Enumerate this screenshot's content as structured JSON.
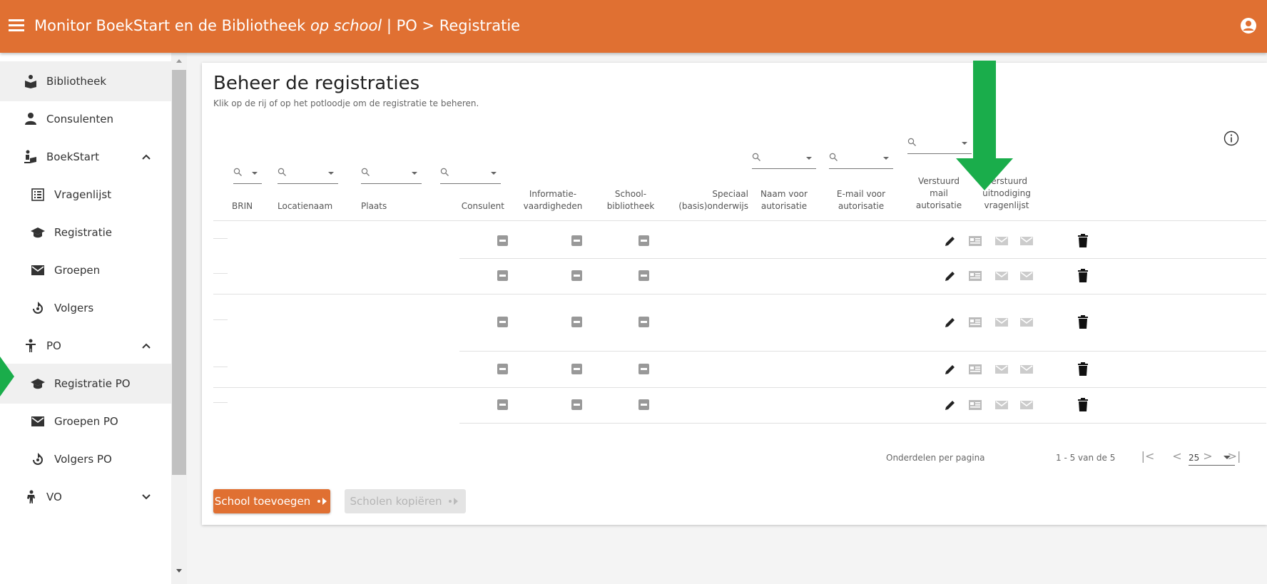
{
  "topbar": {
    "title_prefix": "Monitor BoekStart en de Bibliotheek ",
    "title_italic": "op school",
    "title_suffix": " | PO > Registratie"
  },
  "sidebar": {
    "items": [
      {
        "label": "Bibliotheek",
        "icon": "reading-person-icon"
      },
      {
        "label": "Consulenten",
        "icon": "person-icon"
      },
      {
        "label": "BoekStart",
        "icon": "baby-reading-icon"
      },
      {
        "label": "Vragenlijst",
        "icon": "list-icon"
      },
      {
        "label": "Registratie",
        "icon": "graduation-cap-icon"
      },
      {
        "label": "Groepen",
        "icon": "envelope-icon"
      },
      {
        "label": "Volgers",
        "icon": "follow-icon"
      },
      {
        "label": "PO",
        "icon": "child-icon"
      },
      {
        "label": "Registratie PO",
        "icon": "graduation-cap-icon"
      },
      {
        "label": "Groepen PO",
        "icon": "envelope-icon"
      },
      {
        "label": "Volgers PO",
        "icon": "follow-icon"
      },
      {
        "label": "VO",
        "icon": "teen-icon"
      }
    ]
  },
  "main": {
    "title": "Beheer de registraties",
    "subtitle": "Klik op de rij of op het potloodje om de registratie te beheren.",
    "columns": {
      "brin": "BRIN",
      "locatienaam": "Locatienaam",
      "plaats": "Plaats",
      "consulent": "Consulent",
      "informatie": "Informatie-\nvaardigheden",
      "school": "School-\nbibliotheek",
      "speciaal": "Speciaal\n(basis)onderwijs",
      "naam": "Naam voor\nautorisatie",
      "email": "E-mail voor\nautorisatie",
      "verstuurd_mail": "Verstuurd\nmail\nautorisatie",
      "verstuurd_uitnodiging": "Verstuurd\nuitnodiging\nvragenlijst"
    },
    "row_count": 5,
    "pager": {
      "items_per_page_label": "Onderdelen per pagina",
      "items_per_page": "25",
      "range": "1 - 5 van de 5"
    },
    "buttons": {
      "add_school": "School toevoegen",
      "copy_schools": "Scholen kopiëren"
    }
  },
  "colors": {
    "brand": "#e07032",
    "arrow": "#1aad4b"
  }
}
